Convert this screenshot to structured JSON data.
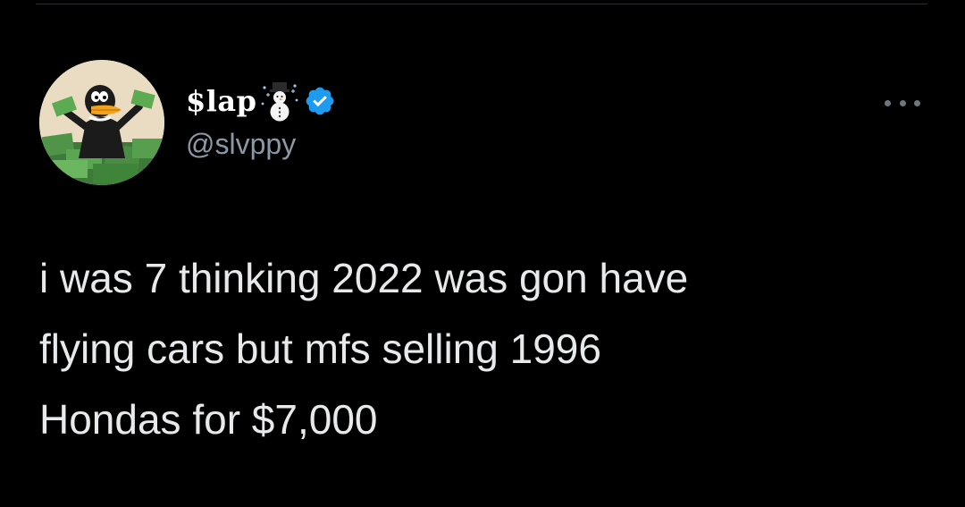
{
  "author": {
    "display_name": "$lap",
    "name_emoji": "snowman-icon",
    "verified": true,
    "handle": "@slvppy",
    "avatar": "daffy-duck-money-avatar"
  },
  "tweet": {
    "lines": [
      "i was 7 thinking 2022 was gon have",
      "flying cars but mfs selling 1996",
      "Hondas for $7,000"
    ]
  },
  "menu": {
    "icon": "more-options-icon"
  },
  "colors": {
    "background": "#000000",
    "text": "#e7e9ea",
    "secondary_text": "#8b98a5",
    "verified_blue": "#1d9bf0"
  }
}
